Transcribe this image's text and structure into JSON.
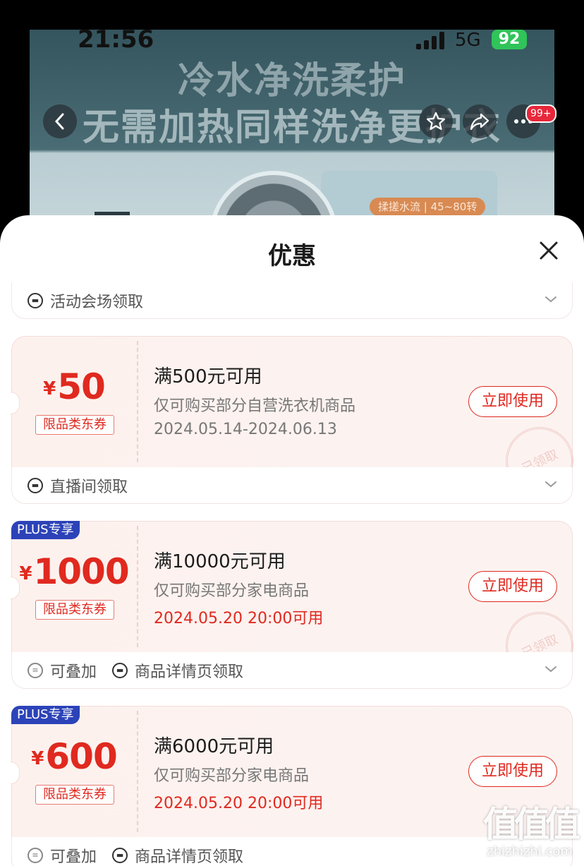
{
  "status_bar": {
    "time": "21:56",
    "network": "5G",
    "battery": "92"
  },
  "background": {
    "banner_line1": "冷水净洗柔护",
    "banner_line2": "无需加热同样洗净更护衣",
    "feature_pill": "揉搓水流 | 45~80转",
    "notification_count": "99+"
  },
  "sheet": {
    "title": "优惠"
  },
  "top_strip": {
    "source": "活动会场领取"
  },
  "coupons": [
    {
      "currency": "¥",
      "amount": "50",
      "type_tag": "限品类东券",
      "condition": "满500元可用",
      "scope": "仅可购买部分自营洗衣机商品",
      "date": "2024.05.14-2024.06.13",
      "button": "立即使用",
      "stamp": "已领取",
      "source": "直播间领取"
    },
    {
      "plus_tag": "PLUS专享",
      "currency": "¥",
      "amount": "1000",
      "type_tag": "限品类东券",
      "condition": "满10000元可用",
      "scope": "仅可购买部分家电商品",
      "date": "2024.05.20 20:00可用",
      "button": "立即使用",
      "stamp": "已领取",
      "stack": "可叠加",
      "source": "商品详情页领取"
    },
    {
      "plus_tag": "PLUS专享",
      "currency": "¥",
      "amount": "600",
      "type_tag": "限品类东券",
      "condition": "满6000元可用",
      "scope": "仅可购买部分家电商品",
      "date": "2024.05.20 20:00可用",
      "button": "立即使用",
      "stack": "可叠加",
      "source": "商品详情页领取"
    }
  ],
  "watermark": {
    "url": "zhizhizhi.com"
  },
  "colors": {
    "accent_red": "#e0291f",
    "plus_blue": "#2c43b8",
    "battery_green": "#30c45a"
  }
}
